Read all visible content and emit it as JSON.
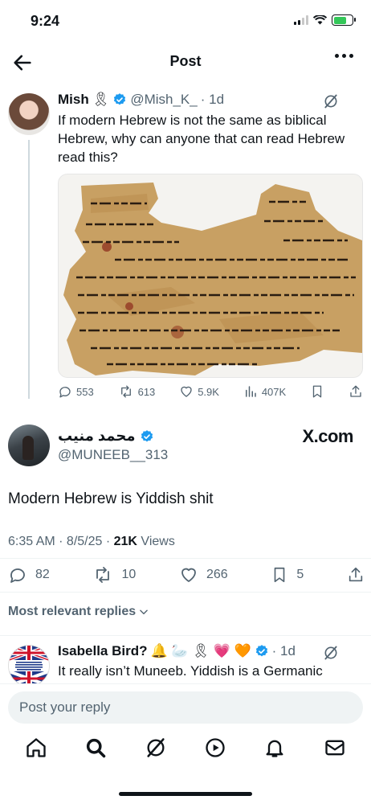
{
  "status": {
    "time": "9:24"
  },
  "header": {
    "title": "Post"
  },
  "quoted": {
    "name": "Mish",
    "emoji": "🎗",
    "handle": "@Mish_K_",
    "age": "· 1d",
    "text": "If modern Hebrew is not the same as biblical Hebrew, why can anyone that can read Hebrew read this?",
    "image": "dead-sea-scroll-fragment",
    "stats": {
      "replies": "553",
      "reposts": "613",
      "likes": "5.9K",
      "views": "407K"
    }
  },
  "tweet": {
    "name": "محمد منيب",
    "handle": "@MUNEEB__313",
    "badge": "X.com",
    "text": "Modern Hebrew is Yiddish shit",
    "time": "6:35 AM · 8/5/25 · ",
    "views_count": "21K",
    "views_label": " Views",
    "stats": {
      "replies": "82",
      "reposts": "10",
      "likes": "266",
      "bookmarks": "5"
    }
  },
  "sort_label": "Most relevant replies",
  "reply": {
    "name": "Isabella Bird?",
    "emojis": "🔔 🦢 🎗 💗 🧡",
    "age": "· 1d",
    "text": "It really isn’t Muneeb. Yiddish is a Germanic",
    "avatar_text": "ALWAYS SUPPORT LOCAL BRITISH BUSINESSES AND BRITISH FARMERS"
  },
  "composer": {
    "placeholder": "Post your reply"
  },
  "colors": {
    "accent": "#1d9bf0",
    "text": "#0f1419",
    "muted": "#536471",
    "scroll": "#c8a063"
  },
  "icons": [
    "back-arrow-icon",
    "more-icon",
    "grok-icon",
    "reply-icon",
    "repost-icon",
    "like-icon",
    "views-icon",
    "bookmark-icon",
    "share-icon",
    "home-icon",
    "search-icon",
    "notifications-icon",
    "messages-icon",
    "spaces-icon"
  ]
}
